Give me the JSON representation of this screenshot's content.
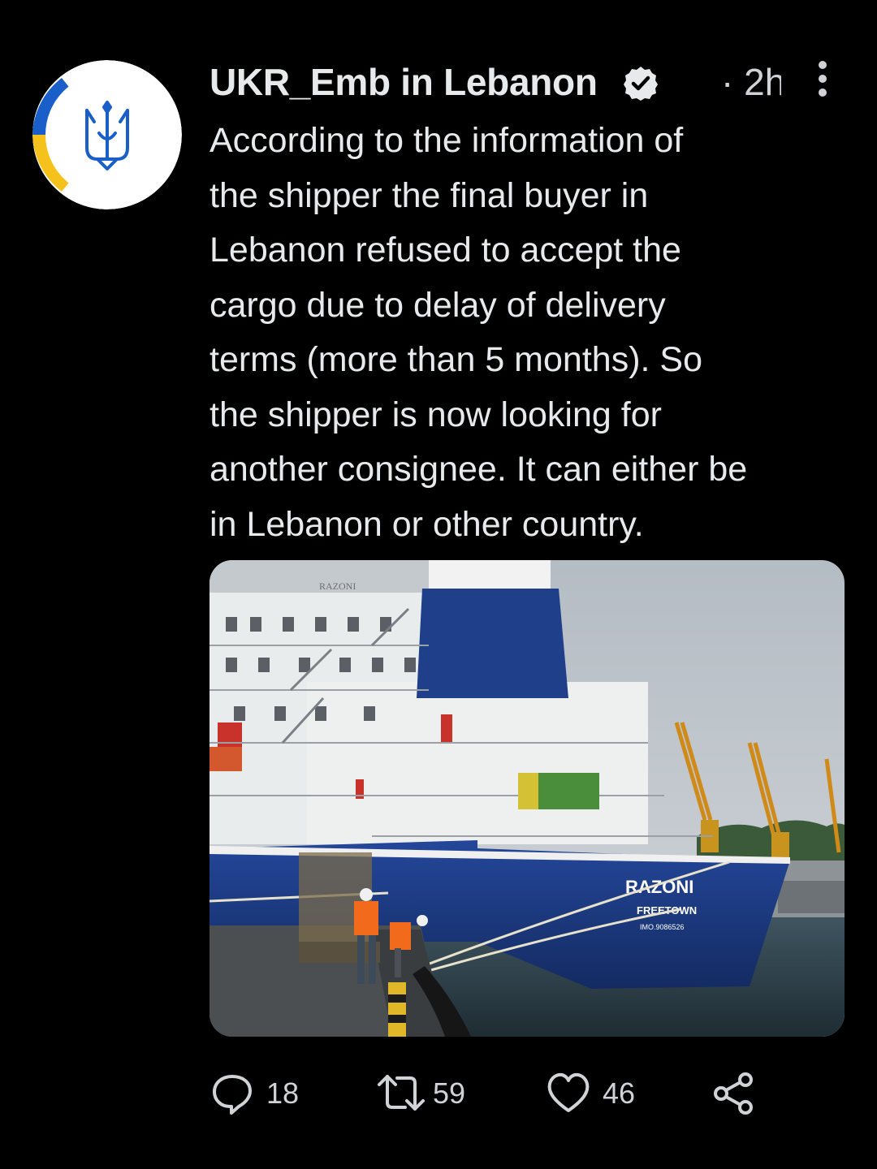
{
  "tweet": {
    "author": {
      "display_name": "UKR_Emb in Lebanon",
      "verified_icon": "verified-badge-icon",
      "avatar_icon": "ukraine-trident-icon"
    },
    "timestamp_separator": "·",
    "timestamp": "2h",
    "more_icon": "more-vertical-icon",
    "text_lines": [
      "According to the information of",
      "the shipper the final buyer in",
      "Lebanon refused to accept the",
      "cargo due to delay of delivery",
      "terms (more than 5 months). So",
      "the shipper is now looking for",
      "another consignee. It can either be",
      "in Lebanon or other country."
    ],
    "media": {
      "ship_name_label": "RAZONI",
      "port_label": "FREETOWN",
      "imo_label": "IMO.9086526",
      "stern_name_label": "RAZONI"
    },
    "actions": {
      "reply": {
        "icon": "reply-icon",
        "count": "18"
      },
      "retweet": {
        "icon": "retweet-icon",
        "count": "59"
      },
      "like": {
        "icon": "heart-icon",
        "count": "46"
      },
      "share": {
        "icon": "share-icon"
      }
    }
  },
  "colors": {
    "background": "#000000",
    "text_primary": "#e7e9ea",
    "text_secondary": "#cfd3d6",
    "ukraine_blue": "#0057b7",
    "ukraine_yellow": "#ffd700",
    "hull_blue": "#1d3d82"
  }
}
